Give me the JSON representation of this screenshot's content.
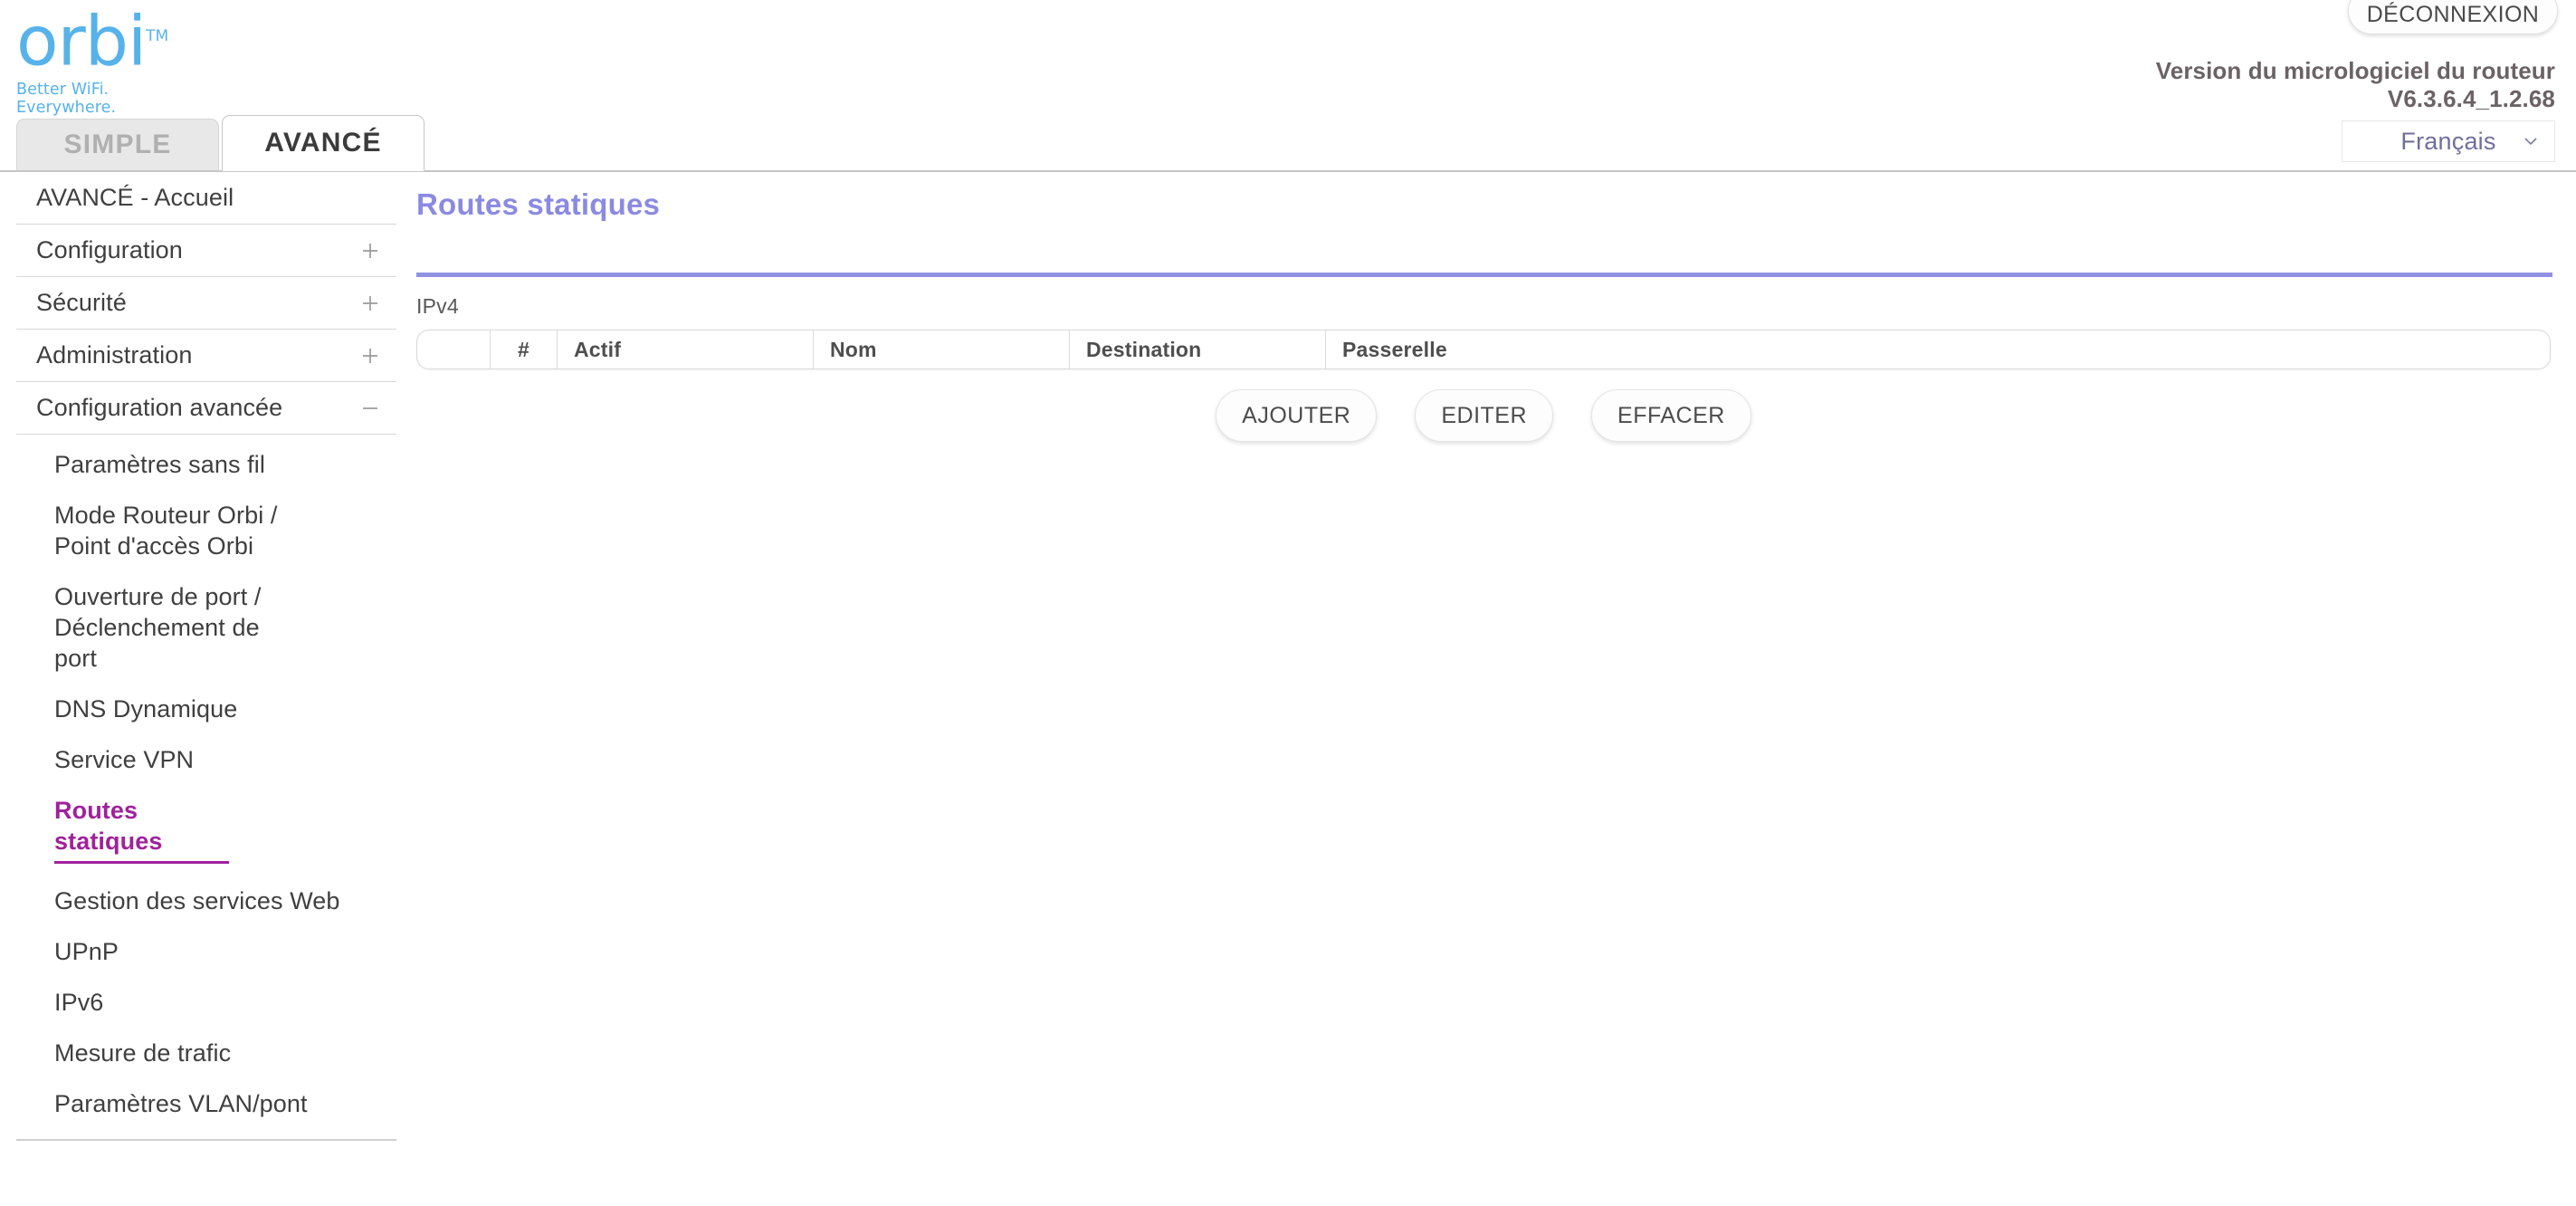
{
  "brand": {
    "logo_text": "orbi",
    "logo_tm": "TM",
    "tagline": "Better WiFi. Everywhere.",
    "logo_color": "#57b2ea"
  },
  "header": {
    "logout_label": "DÉCONNEXION",
    "firmware_label": "Version du micrologiciel du routeur",
    "firmware_version": "V6.3.6.4_1.2.68",
    "language_value": "Français",
    "chevron_icon": "chevron-down-icon"
  },
  "tabs": [
    {
      "label": "SIMPLE",
      "active": false
    },
    {
      "label": "AVANCÉ",
      "active": true
    }
  ],
  "sidebar": {
    "top_items": [
      {
        "label": "AVANCÉ - Accueil",
        "expand": ""
      },
      {
        "label": "Configuration",
        "expand": "+"
      },
      {
        "label": "Sécurité",
        "expand": "+"
      },
      {
        "label": "Administration",
        "expand": "+"
      },
      {
        "label": "Configuration avancée",
        "expand": "−"
      }
    ],
    "sub_items": [
      {
        "label": "Paramètres sans fil",
        "active": false
      },
      {
        "label": "Mode Routeur Orbi / Point d'accès Orbi",
        "active": false
      },
      {
        "label": "Ouverture de port / Déclenchement de port",
        "active": false
      },
      {
        "label": "DNS Dynamique",
        "active": false
      },
      {
        "label": "Service VPN",
        "active": false
      },
      {
        "label": "Routes statiques",
        "active": true
      },
      {
        "label": "Gestion des services Web",
        "active": false
      },
      {
        "label": "UPnP",
        "active": false
      },
      {
        "label": "IPv6",
        "active": false
      },
      {
        "label": "Mesure de trafic",
        "active": false
      },
      {
        "label": "Paramètres VLAN/pont",
        "active": false
      }
    ],
    "active_color": "#a0219c"
  },
  "main": {
    "title": "Routes statiques",
    "title_color": "#8a8ae2",
    "section_label": "IPv4",
    "table": {
      "columns": [
        "",
        "#",
        "Actif",
        "Nom",
        "Destination",
        "Passerelle"
      ],
      "rows": []
    },
    "buttons": [
      {
        "label": "AJOUTER"
      },
      {
        "label": "EDITER"
      },
      {
        "label": "EFFACER"
      }
    ]
  }
}
